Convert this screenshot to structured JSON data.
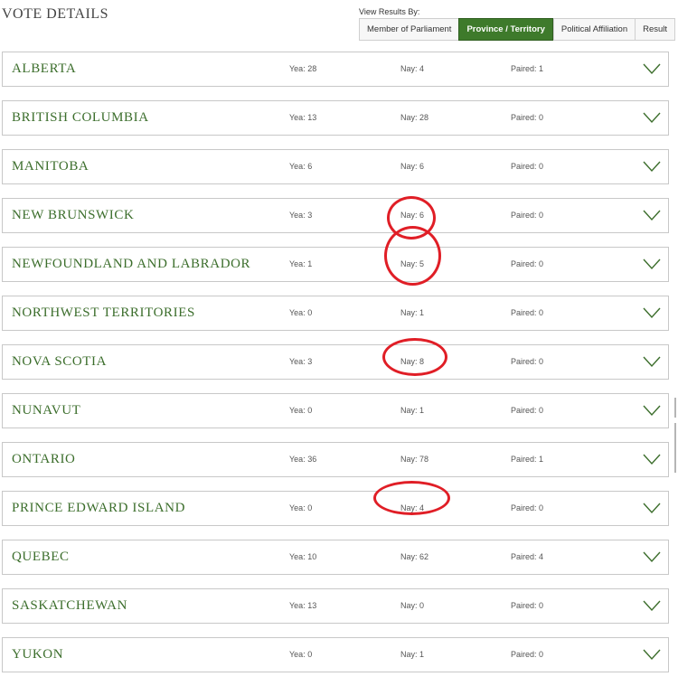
{
  "header": {
    "title": "VOTE DETAILS",
    "view_label": "View Results By:",
    "view_options": [
      "Member of Parliament",
      "Province / Territory",
      "Political Affiliation",
      "Result"
    ],
    "active_view": "Province / Territory"
  },
  "rows": [
    {
      "name": "ALBERTA",
      "yea": "Yea: 28",
      "nay": "Nay: 4",
      "paired": "Paired: 1"
    },
    {
      "name": "BRITISH COLUMBIA",
      "yea": "Yea: 13",
      "nay": "Nay: 28",
      "paired": "Paired: 0"
    },
    {
      "name": "MANITOBA",
      "yea": "Yea: 6",
      "nay": "Nay: 6",
      "paired": "Paired: 0"
    },
    {
      "name": "NEW BRUNSWICK",
      "yea": "Yea: 3",
      "nay": "Nay: 6",
      "paired": "Paired: 0"
    },
    {
      "name": "NEWFOUNDLAND AND LABRADOR",
      "yea": "Yea: 1",
      "nay": "Nay: 5",
      "paired": "Paired: 0"
    },
    {
      "name": "NORTHWEST TERRITORIES",
      "yea": "Yea: 0",
      "nay": "Nay: 1",
      "paired": "Paired: 0"
    },
    {
      "name": "NOVA SCOTIA",
      "yea": "Yea: 3",
      "nay": "Nay: 8",
      "paired": "Paired: 0"
    },
    {
      "name": "NUNAVUT",
      "yea": "Yea: 0",
      "nay": "Nay: 1",
      "paired": "Paired: 0"
    },
    {
      "name": "ONTARIO",
      "yea": "Yea: 36",
      "nay": "Nay: 78",
      "paired": "Paired: 1"
    },
    {
      "name": "PRINCE EDWARD ISLAND",
      "yea": "Yea: 0",
      "nay": "Nay: 4",
      "paired": "Paired: 0"
    },
    {
      "name": "QUEBEC",
      "yea": "Yea: 10",
      "nay": "Nay: 62",
      "paired": "Paired: 4"
    },
    {
      "name": "SASKATCHEWAN",
      "yea": "Yea: 13",
      "nay": "Nay: 0",
      "paired": "Paired: 0"
    },
    {
      "name": "YUKON",
      "yea": "Yea: 0",
      "nay": "Nay: 1",
      "paired": "Paired: 0"
    }
  ],
  "icons": {
    "row_toggle": "chevron-down-icon"
  },
  "colors": {
    "accent": "#3e7a2b",
    "name_text": "#3c6e2c",
    "annotation": "#e01e26"
  }
}
